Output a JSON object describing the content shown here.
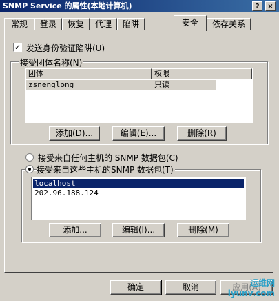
{
  "window": {
    "title": "SNMP Service 的属性(本地计算机)",
    "help_label": "?",
    "close_label": "×"
  },
  "tabs": [
    {
      "label": "常规"
    },
    {
      "label": "登录"
    },
    {
      "label": "恢复"
    },
    {
      "label": "代理"
    },
    {
      "label": "陷阱"
    },
    {
      "label": "安全",
      "active": true
    },
    {
      "label": "依存关系"
    }
  ],
  "auth_trap": {
    "label": "发送身份验证陷阱(U)",
    "checked": true,
    "check_glyph": "✓"
  },
  "community_group": {
    "title": "接受团体名称(N)",
    "columns": [
      "团体",
      "权限"
    ],
    "rows": [
      {
        "name": "zsnenglong",
        "right": "只读"
      }
    ],
    "buttons": {
      "add": "添加(D)...",
      "edit": "编辑(E)...",
      "remove": "删除(R)"
    }
  },
  "hosts": {
    "any_label": "接受来自任何主机的 SNMP 数据包(C)",
    "these_label": "接受来自这些主机的SNMP 数据包(T)",
    "selected_option": "these",
    "list": [
      "localhost",
      "202.96.188.124"
    ],
    "buttons": {
      "add": "添加...",
      "edit": "编辑(I)...",
      "remove": "删除(M)"
    }
  },
  "footer": {
    "ok": "确定",
    "cancel": "取消",
    "apply": "应用(A)"
  },
  "watermark": {
    "line1": "运维网",
    "line2": "iyunv.com"
  },
  "colors": {
    "titlebar": "#0a246a",
    "selection": "#0a246a",
    "face": "#d4d0c8"
  }
}
